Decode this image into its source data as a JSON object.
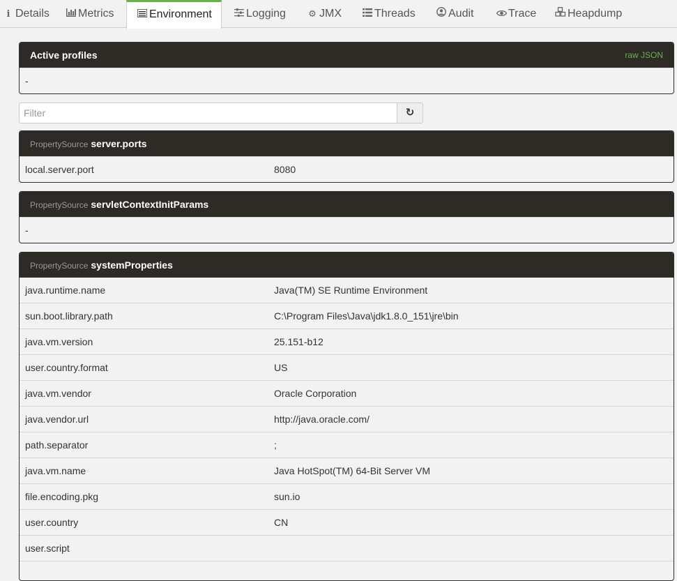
{
  "tabs": [
    {
      "label": "Details",
      "icon": "info-icon"
    },
    {
      "label": "Metrics",
      "icon": "bar-chart-icon"
    },
    {
      "label": "Environment",
      "icon": "list-icon"
    },
    {
      "label": "Logging",
      "icon": "sliders-icon"
    },
    {
      "label": "JMX",
      "icon": "cogs-icon"
    },
    {
      "label": "Threads",
      "icon": "lines-icon"
    },
    {
      "label": "Audit",
      "icon": "user-circle-icon"
    },
    {
      "label": "Trace",
      "icon": "eye-icon"
    },
    {
      "label": "Heapdump",
      "icon": "cubes-icon"
    }
  ],
  "active_tab": "Environment",
  "profiles": {
    "title": "Active profiles",
    "raw_json": "raw JSON",
    "value": "-"
  },
  "filter": {
    "placeholder": "Filter",
    "refresh_icon": "refresh-icon"
  },
  "sources": [
    {
      "prefix": "PropertySource",
      "name": "server.ports",
      "rows": [
        {
          "key": "local.server.port",
          "value": "8080"
        }
      ]
    },
    {
      "prefix": "PropertySource",
      "name": "servletContextInitParams",
      "empty": "-"
    },
    {
      "prefix": "PropertySource",
      "name": "systemProperties",
      "rows": [
        {
          "key": "java.runtime.name",
          "value": "Java(TM) SE Runtime Environment"
        },
        {
          "key": "sun.boot.library.path",
          "value": "C:\\Program Files\\Java\\jdk1.8.0_151\\jre\\bin"
        },
        {
          "key": "java.vm.version",
          "value": "25.151-b12"
        },
        {
          "key": "user.country.format",
          "value": "US"
        },
        {
          "key": "java.vm.vendor",
          "value": "Oracle Corporation"
        },
        {
          "key": "java.vendor.url",
          "value": "http://java.oracle.com/"
        },
        {
          "key": "path.separator",
          "value": ";"
        },
        {
          "key": "java.vm.name",
          "value": "Java HotSpot(TM) 64-Bit Server VM"
        },
        {
          "key": "file.encoding.pkg",
          "value": "sun.io"
        },
        {
          "key": "user.country",
          "value": "CN"
        },
        {
          "key": "user.script",
          "value": ""
        }
      ]
    }
  ]
}
